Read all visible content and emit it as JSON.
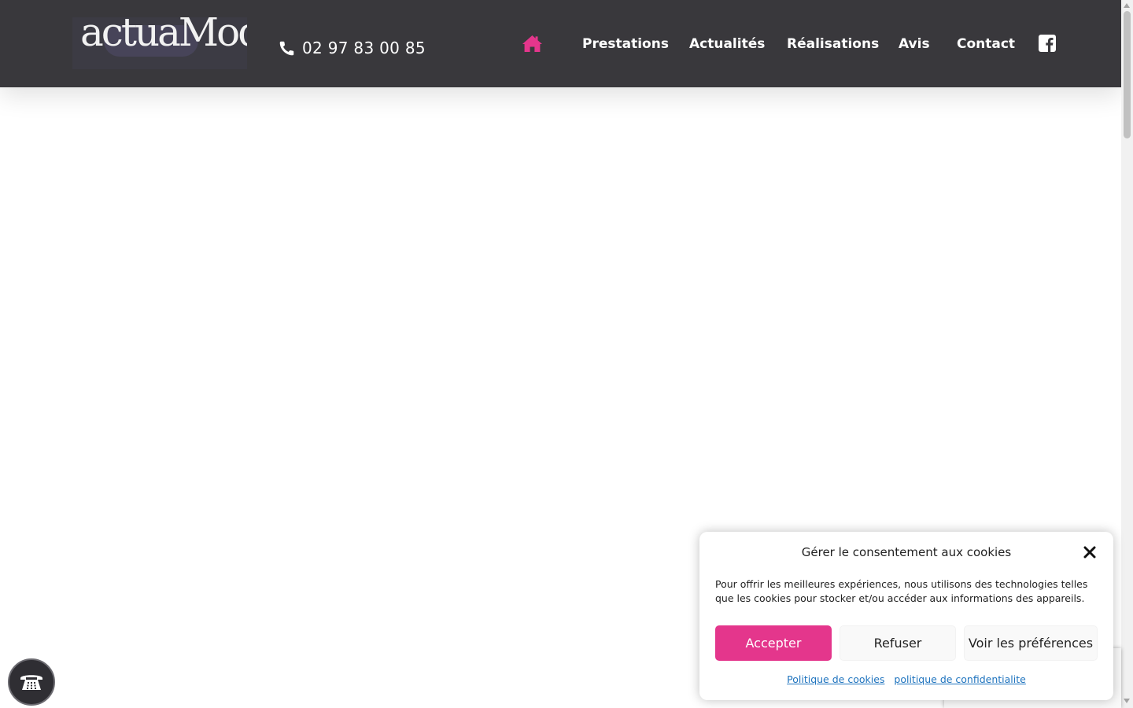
{
  "header": {
    "logo_text": "actuaMod",
    "phone": "02 97 83 00 85",
    "nav": [
      {
        "label": "Prestations"
      },
      {
        "label": "Actualités"
      },
      {
        "label": "Réalisations"
      },
      {
        "label": "Avis"
      },
      {
        "label": "Contact"
      }
    ],
    "home_icon": "home-icon",
    "social_icon": "facebook-icon"
  },
  "colors": {
    "header_bg": "#39383c",
    "accent": "#e4368c",
    "link": "#1e73be"
  },
  "cookie_banner": {
    "title": "Gérer le consentement aux cookies",
    "text": "Pour offrir les meilleures expériences, nous utilisons des technologies telles que les cookies pour stocker et/ou accéder aux informations des appareils.",
    "accept_label": "Accepter",
    "refuse_label": "Refuser",
    "prefs_label": "Voir les préférences",
    "links": [
      {
        "label": "Politique de cookies"
      },
      {
        "label": "politique de confidentialite"
      }
    ]
  },
  "floating_call": {
    "icon": "telephone-icon"
  }
}
